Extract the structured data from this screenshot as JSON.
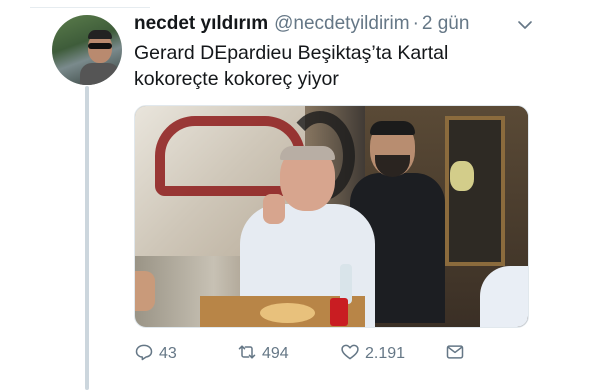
{
  "tweet": {
    "author_name": "necdet yıldırım",
    "author_handle": "@necdetyildirim",
    "separator": "·",
    "time": "2 gün",
    "text_line1": "Gerard DEpardieu Beşiktaş’ta Kartal",
    "text_line2": "kokoreçte kokoreç yiyor"
  },
  "actions": {
    "reply_count": "43",
    "retweet_count": "494",
    "like_count": "2.191"
  },
  "icons": {
    "caret": "chevron-down-icon",
    "reply": "reply-icon",
    "retweet": "retweet-icon",
    "like": "heart-icon",
    "dm": "envelope-icon"
  },
  "colors": {
    "text": "#14171a",
    "secondary": "#657786",
    "thread_line": "#ccd6dd"
  }
}
